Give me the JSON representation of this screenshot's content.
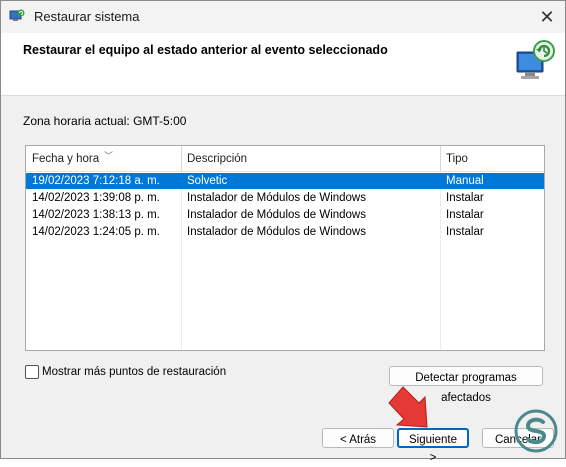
{
  "window": {
    "title": "Restaurar sistema"
  },
  "header": {
    "title": "Restaurar el equipo al estado anterior al evento seleccionado"
  },
  "timezone_label": "Zona horaria actual: GMT-5:00",
  "list": {
    "columns": [
      "Fecha y hora",
      "Descripción",
      "Tipo"
    ],
    "rows": [
      {
        "date": "19/02/2023 7:12:18 a. m.",
        "description": "Solvetic",
        "type": "Manual",
        "selected": true
      },
      {
        "date": "14/02/2023 1:39:08 p. m.",
        "description": "Instalador de Módulos de Windows",
        "type": "Instalar",
        "selected": false
      },
      {
        "date": "14/02/2023 1:38:13 p. m.",
        "description": "Instalador de Módulos de Windows",
        "type": "Instalar",
        "selected": false
      },
      {
        "date": "14/02/2023 1:24:05 p. m.",
        "description": "Instalador de Módulos de Windows",
        "type": "Instalar",
        "selected": false
      }
    ]
  },
  "checkbox": {
    "label": "Mostrar más puntos de restauración",
    "checked": false
  },
  "buttons": {
    "detect": "Detectar programas afectados",
    "back": "< Atrás",
    "next": "Siguiente >",
    "cancel": "Cancelar"
  },
  "colors": {
    "selection": "#0078d7",
    "accent": "#0067c0",
    "arrow": "#e53935",
    "logo": "#4a8a8c"
  },
  "icons": [
    "system-restore-app-icon",
    "close-icon",
    "system-restore-header-icon",
    "sort-caret-icon",
    "red-arrow-annotation",
    "solvetic-logo"
  ]
}
